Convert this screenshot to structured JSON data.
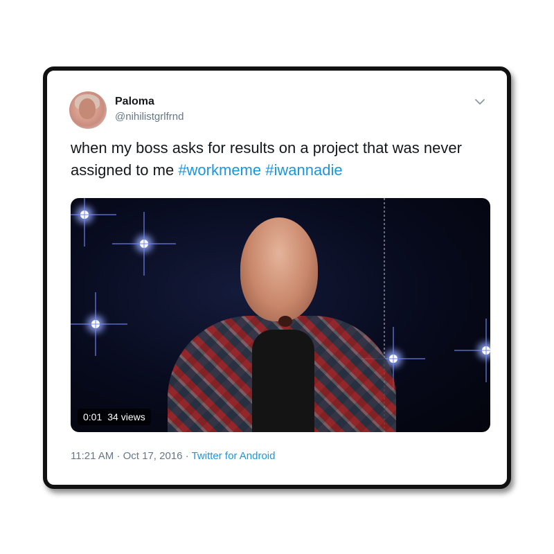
{
  "tweet": {
    "author_name": "Paloma",
    "author_handle": "@nihilistgrlfrnd",
    "text_plain": "when my boss asks for results on a project that was never assigned to me ",
    "hashtags": [
      "#workmeme",
      "#iwannadie"
    ],
    "caret_icon": "chevron-down-icon"
  },
  "video": {
    "time": "0:01",
    "views": "34 views"
  },
  "meta": {
    "time": "11:21 AM",
    "separator": "·",
    "date": "Oct 17, 2016",
    "source": "Twitter for Android"
  },
  "colors": {
    "link": "#1b95e0",
    "secondary_text": "#657786",
    "primary_text": "#14171a",
    "card_border": "#111111"
  }
}
